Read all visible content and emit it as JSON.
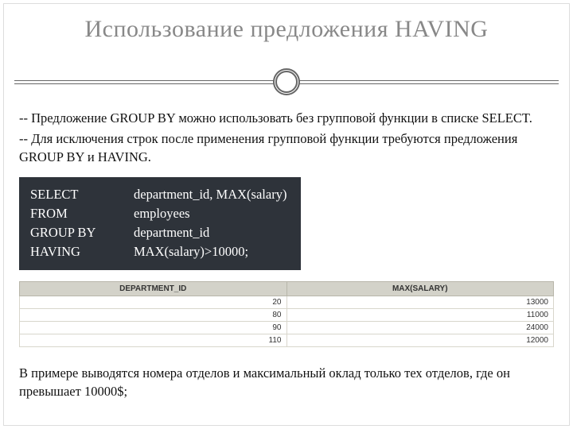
{
  "title": "Использование предложения HAVING",
  "para1": "-- Предложение GROUP BY можно использовать без групповой функции в списке SELECT.",
  "para2": "-- Для исключения строк после применения групповой функции требуются предложения GROUP BY и HAVING.",
  "sql": {
    "rows": [
      {
        "kw": "SELECT",
        "rest": "department_id, MAX(salary)"
      },
      {
        "kw": "FROM",
        "rest": "employees"
      },
      {
        "kw": "GROUP BY",
        "rest": "department_id"
      },
      {
        "kw": "HAVING",
        "rest": "MAX(salary)>10000;"
      }
    ]
  },
  "table": {
    "headers": [
      "DEPARTMENT_ID",
      "MAX(SALARY)"
    ],
    "rows": [
      [
        "20",
        "13000"
      ],
      [
        "80",
        "11000"
      ],
      [
        "90",
        "24000"
      ],
      [
        "110",
        "12000"
      ]
    ]
  },
  "note": "В примере выводятся номера отделов и максимальный оклад только тех отделов, где он превышает 10000$;"
}
